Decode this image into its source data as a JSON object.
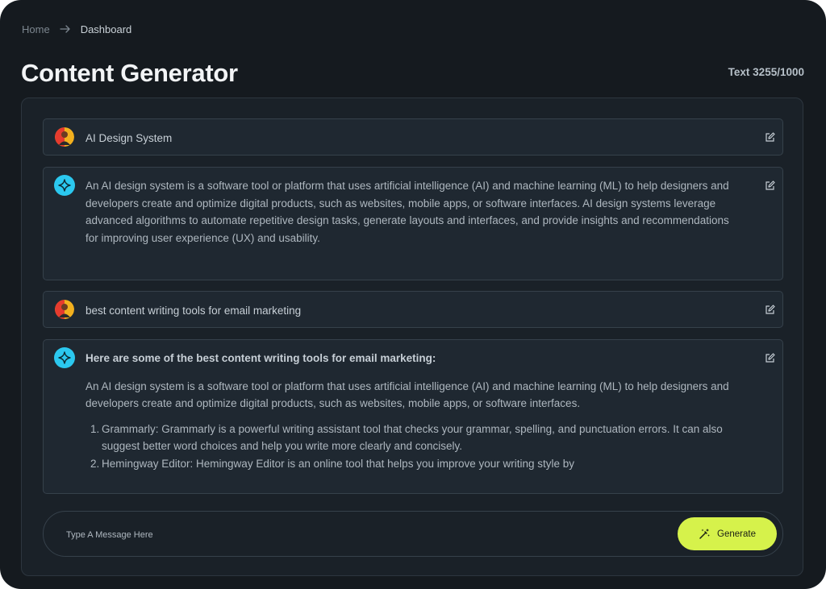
{
  "breadcrumb": {
    "home": "Home",
    "current": "Dashboard"
  },
  "header": {
    "title": "Content Generator",
    "counter": "Text 3255/1000"
  },
  "messages": {
    "q1": "AI Design System",
    "a1": "An AI design system is a software tool or platform that uses artificial intelligence (AI) and machine learning (ML) to help designers and developers create and optimize digital products, such as websites, mobile apps, or software interfaces. AI design systems leverage advanced algorithms to automate repetitive design tasks, generate layouts and interfaces, and provide insights and recommendations for improving user experience (UX) and usability.",
    "q2": "best content writing tools for email marketing",
    "a2": {
      "heading": "Here are some of the best content writing tools for email marketing:",
      "intro": "An AI design system is a software tool or platform that uses artificial intelligence (AI) and machine learning (ML) to help designers and developers create and optimize digital products, such as websites, mobile apps, or software interfaces.",
      "items": [
        {
          "num": "1.",
          "text": "Grammarly: Grammarly is a powerful writing assistant tool that checks your grammar, spelling, and punctuation errors. It can also suggest better word choices and help you write more clearly and concisely."
        },
        {
          "num": "2.",
          "text": "Hemingway Editor: Hemingway Editor is an online tool that helps you improve your writing style by"
        }
      ]
    }
  },
  "composer": {
    "placeholder": "Type A Message Here",
    "button": "Generate"
  },
  "colors": {
    "background": "#151a1f",
    "panel": "#1a2128",
    "accent": "#d6f24b",
    "ai_icon": "#2bc8ef"
  },
  "icons": [
    "arrow-right-icon",
    "user-avatar",
    "sparkle-icon",
    "edit-icon",
    "magic-wand-icon"
  ]
}
